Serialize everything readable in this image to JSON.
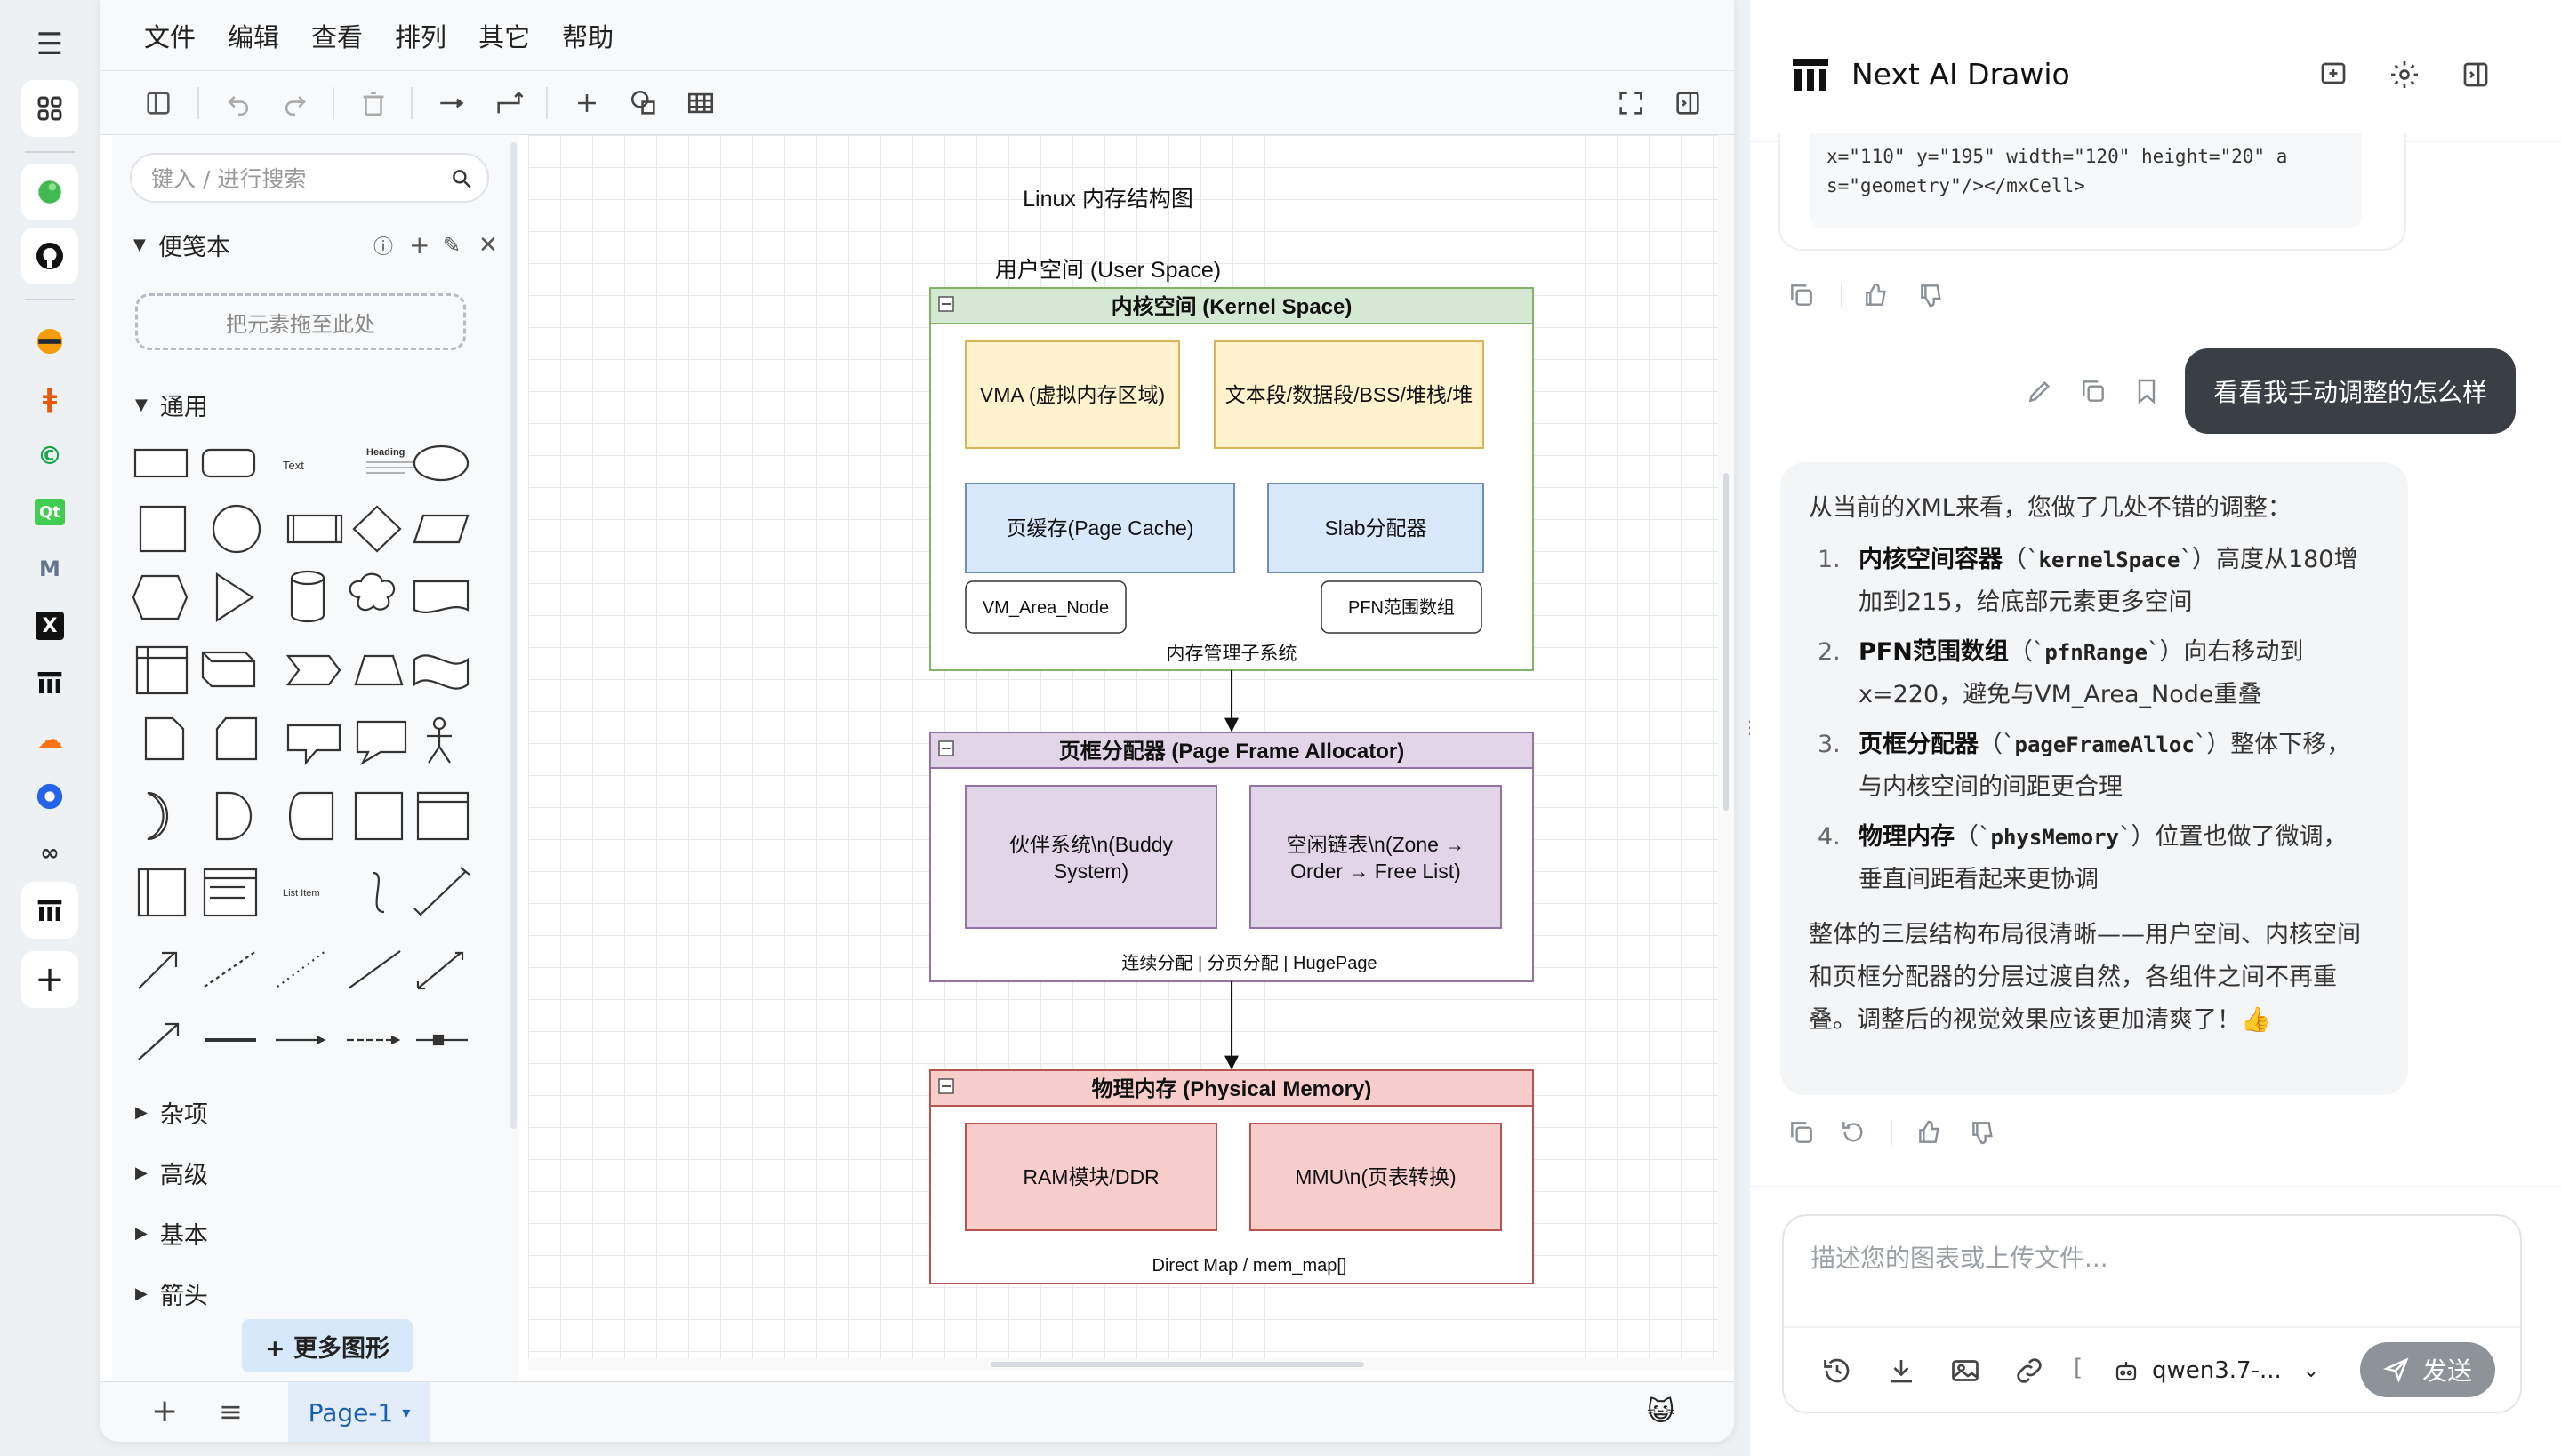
{
  "menubar": {
    "items": [
      "文件",
      "编辑",
      "查看",
      "排列",
      "其它",
      "帮助"
    ]
  },
  "sidebar": {
    "search_placeholder": "键入 / 进行搜索",
    "scratchpad_title": "便笺本",
    "dropzone_text": "把元素拖至此处",
    "general_title": "通用",
    "shape_labels": {
      "text": "Text",
      "heading": "Heading",
      "list_item": "List Item"
    },
    "sections": [
      "杂项",
      "高级",
      "基本",
      "箭头"
    ],
    "more_shapes": "+ 更多图形"
  },
  "footer": {
    "page_tab": "Page-1"
  },
  "diagram": {
    "title": "Linux 内存结构图",
    "user_space": "用户空间 (User Space)",
    "kernel": {
      "header": "内核空间 (Kernel Space)",
      "vma": "VMA (虚拟内存区域)",
      "segments": "文本段/数据段/BSS/堆栈/堆",
      "page_cache": "页缓存(Page Cache)",
      "slab": "Slab分配器",
      "vm_area_node": "VM_Area_Node",
      "pfn": "PFN范围数组",
      "footer": "内存管理子系统"
    },
    "allocator": {
      "header": "页框分配器 (Page Frame Allocator)",
      "buddy_line1": "伙伴系统\\n(Buddy",
      "buddy_line2": "System)",
      "freelist_line1": "空闲链表\\n(Zone →",
      "freelist_line2": "Order → Free List)",
      "footer": "连续分配 | 分页分配 | HugePage"
    },
    "physical": {
      "header": "物理内存 (Physical Memory)",
      "ram": "RAM模块/DDR",
      "mmu": "MMU\\n(页表转换)",
      "footer": "Direct Map / mem_map[]"
    }
  },
  "chat": {
    "app_title": "Next AI Drawio",
    "code_line1": "x=\"110\" y=\"195\" width=\"120\" height=\"20\" a",
    "code_line2": "s=\"geometry\"/></mxCell>",
    "user_message": "看看我手动调整的怎么样",
    "ai_intro": "从当前的XML来看，您做了几处不错的调整：",
    "ai_items": [
      {
        "num": "1.",
        "bold": "内核空间容器",
        "code": "kernelSpace",
        "line1_rest": "）高度从180增",
        "line2": "加到215，给底部元素更多空间"
      },
      {
        "num": "2.",
        "bold": "PFN范围数组",
        "code": "pfnRange",
        "line1_rest": "）向右移动到",
        "line2": "x=220，避免与VM_Area_Node重叠"
      },
      {
        "num": "3.",
        "bold": "页框分配器",
        "code": "pageFrameAlloc",
        "line1_rest": "）整体下移，",
        "line2": "与内核空间的间距更合理"
      },
      {
        "num": "4.",
        "bold": "物理内存",
        "code": "physMemory",
        "line1_rest": "）位置也做了微调，",
        "line2": "垂直间距看起来更协调"
      }
    ],
    "ai_summary_1": "整体的三层结构布局很清晰——用户空间、内核空间",
    "ai_summary_2": "和页框分配器的分层过渡自然，各组件之间不再重",
    "ai_summary_3": "叠。调整后的视觉效果应该更加清爽了！👍",
    "input_placeholder": "描述您的图表或上传文件...",
    "model": "qwen3.7-...",
    "send": "发送"
  },
  "colors": {
    "kernel_fill": "#d5e8d4",
    "kernel_stroke": "#82b366",
    "yellow_fill": "#fff2cc",
    "yellow_stroke": "#d6b656",
    "blue_fill": "#dae8fc",
    "blue_stroke": "#6c8ebf",
    "purple_fill": "#e1d5e7",
    "purple_stroke": "#9673a6",
    "red_fill": "#f8cecc",
    "red_stroke": "#b85450"
  }
}
